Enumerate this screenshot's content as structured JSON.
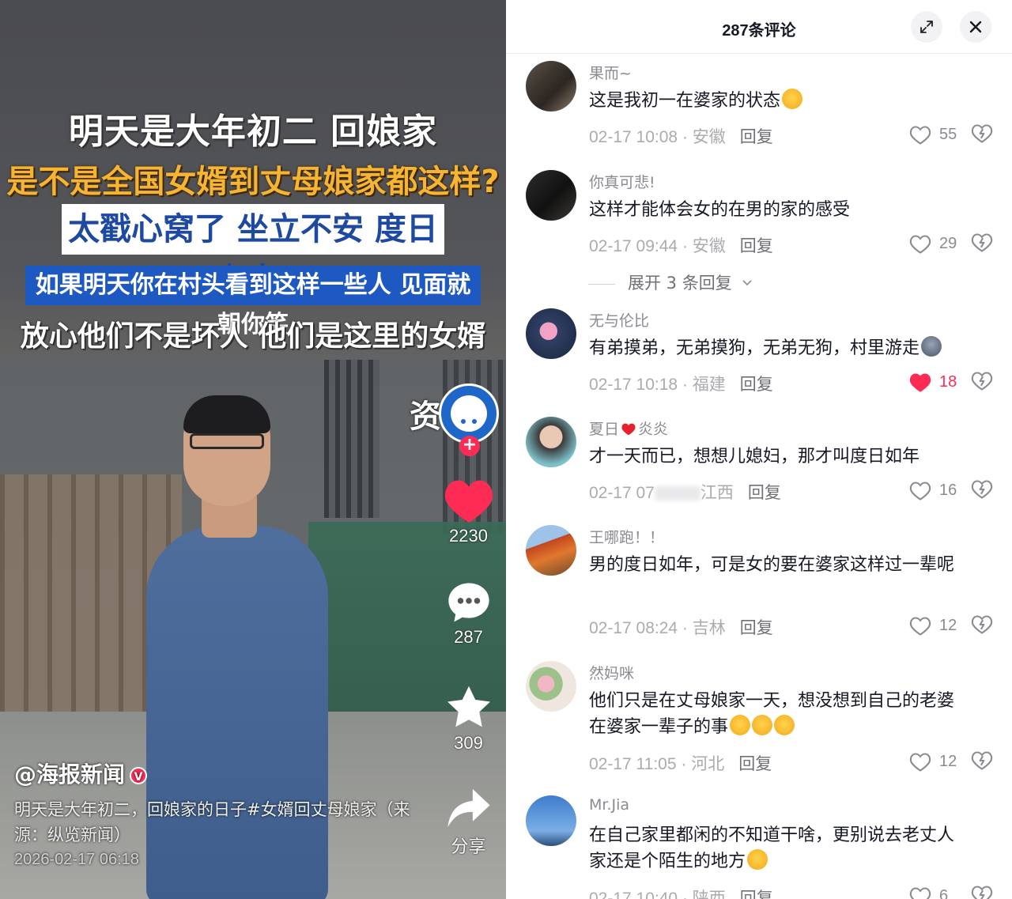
{
  "video": {
    "overlay": {
      "line1": "明天是大年初二 回娘家",
      "line2": "是不是全国女婿到丈母娘家都这样?",
      "line3": "太戳心窝了 坐立不安 度日如年",
      "line4": "如果明天你在村头看到这样一些人 见面就朝你笑",
      "line5": "放心他们不是坏人 他们是这里的女婿"
    },
    "cut_text": "资",
    "author": "@海报新闻",
    "description": "明天是大年初二，回娘家的日子#女婿回丈母娘家（来源：纵览新闻）",
    "date": "2026-02-17 06:18",
    "actions": {
      "likes": "2230",
      "comments": "287",
      "favorites": "309",
      "share_label": "分享"
    }
  },
  "panel": {
    "title": "287条评论",
    "reply_label": "回复",
    "expand_label": "展开 3 条回复"
  },
  "comments": [
    {
      "name": "果而~",
      "text": "这是我初一在婆家的状态",
      "time": "02-17 10:08",
      "region": "安徽",
      "likes": "55"
    },
    {
      "name": "你真可悲!",
      "text": "这样才能体会女的在男的家的感受",
      "time": "02-17 09:44",
      "region": "安徽",
      "likes": "29"
    },
    {
      "name": "无与伦比",
      "text": "有弟摸弟，无弟摸狗，无弟无狗，村里游走",
      "time": "02-17 10:18",
      "region": "福建",
      "likes": "18"
    },
    {
      "name_a": "夏日",
      "name_b": "炎炎",
      "text": "才一天而已，想想儿媳妇，那才叫度日如年",
      "time": "02-17 07",
      "region": "江西",
      "likes": "16"
    },
    {
      "name": "王哪跑！！",
      "text": "男的度日如年，可是女的要在婆家这样过一辈呢",
      "time": "02-17 08:24",
      "region": "吉林",
      "likes": "12"
    },
    {
      "name": "然妈咪",
      "text": "他们只是在丈母娘家一天，想没想到自己的老婆在婆家一辈子的事",
      "time": "02-17 11:05",
      "region": "河北",
      "likes": "12"
    },
    {
      "name": "Mr.Jia",
      "text": "在自己家里都闲的不知道干啥，更别说去老丈人家还是个陌生的地方",
      "time": "02-17 10:40",
      "region": "陕西",
      "likes": "6"
    }
  ],
  "colors": {
    "accent_red": "#fe2c55",
    "liked_heart": "#fe2c55",
    "meta_gray": "#aaabae",
    "title_dark": "#161823"
  },
  "icons": [
    "expand-icon",
    "close-icon",
    "heart-icon",
    "dislike-icon",
    "comment-icon",
    "star-icon",
    "share-icon"
  ]
}
